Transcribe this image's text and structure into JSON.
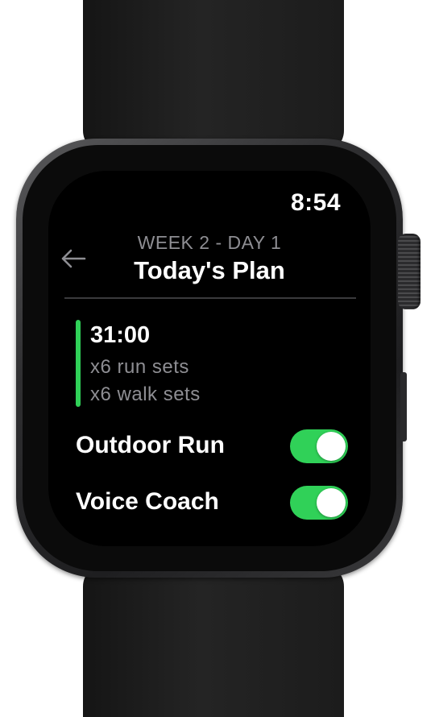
{
  "status": {
    "time": "8:54"
  },
  "header": {
    "subtitle": "WEEK 2 - DAY 1",
    "title": "Today's Plan",
    "back_icon": "arrow-left-icon"
  },
  "plan": {
    "duration": "31:00",
    "lines": [
      "x6 run sets",
      "x6 walk sets"
    ],
    "accent_color": "#30d158"
  },
  "settings": [
    {
      "label": "Outdoor Run",
      "enabled": true
    },
    {
      "label": "Voice Coach",
      "enabled": true
    }
  ],
  "colors": {
    "toggle_on": "#30d158",
    "secondary_text": "#8e8e93",
    "background": "#000000"
  }
}
